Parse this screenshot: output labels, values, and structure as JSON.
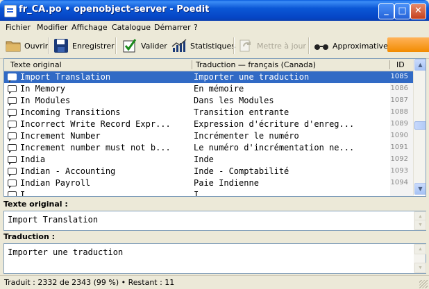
{
  "window": {
    "title": "fr_CA.po • openobject-server - Poedit",
    "minimize": "_",
    "maximize": "□",
    "close": "✕"
  },
  "menu": [
    "Fichier",
    "Modifier",
    "Affichage",
    "Catalogue",
    "Démarrer",
    "?"
  ],
  "toolbar": {
    "open": "Ouvrir",
    "save": "Enregistrer",
    "validate": "Valider",
    "stats": "Statistiques",
    "update": "Mettre à jour",
    "fuzzy": "Approximative"
  },
  "list": {
    "headers": {
      "source": "Texte original",
      "translation": "Traduction — français (Canada)",
      "id": "ID"
    },
    "rows": [
      {
        "source": "Import Translation",
        "translation": "Importer une traduction",
        "id": "1085",
        "selected": true
      },
      {
        "source": "In Memory",
        "translation": "En mémoire",
        "id": "1086"
      },
      {
        "source": "In Modules",
        "translation": "Dans les Modules",
        "id": "1087"
      },
      {
        "source": "Incoming Transitions",
        "translation": "Transition entrante",
        "id": "1088"
      },
      {
        "source": "Incorrect Write Record Expr...",
        "translation": "Expression d'écriture d'enreg...",
        "id": "1089"
      },
      {
        "source": "Increment Number",
        "translation": "Incrémenter le numéro",
        "id": "1090"
      },
      {
        "source": "Increment number must not b...",
        "translation": "Le numéro d'incrémentation ne...",
        "id": "1091"
      },
      {
        "source": "India",
        "translation": "Inde",
        "id": "1092"
      },
      {
        "source": "Indian - Accounting",
        "translation": "Inde - Comptabilité",
        "id": "1093"
      },
      {
        "source": "Indian Payroll",
        "translation": "Paie Indienne",
        "id": "1094"
      },
      {
        "source": "I...",
        "translation": "I...",
        "id": ""
      }
    ]
  },
  "source_panel": {
    "label": "Texte original :",
    "text": "Import Translation"
  },
  "translation_panel": {
    "label": "Traduction :",
    "text": "Importer une traduction"
  },
  "status": "Traduit : 2332 de 2343 (99 %)  •  Restant : 11",
  "colors": {
    "selection": "#316AC5",
    "titlebar": "#0B57D6",
    "accent_orange": "#F28B00"
  }
}
